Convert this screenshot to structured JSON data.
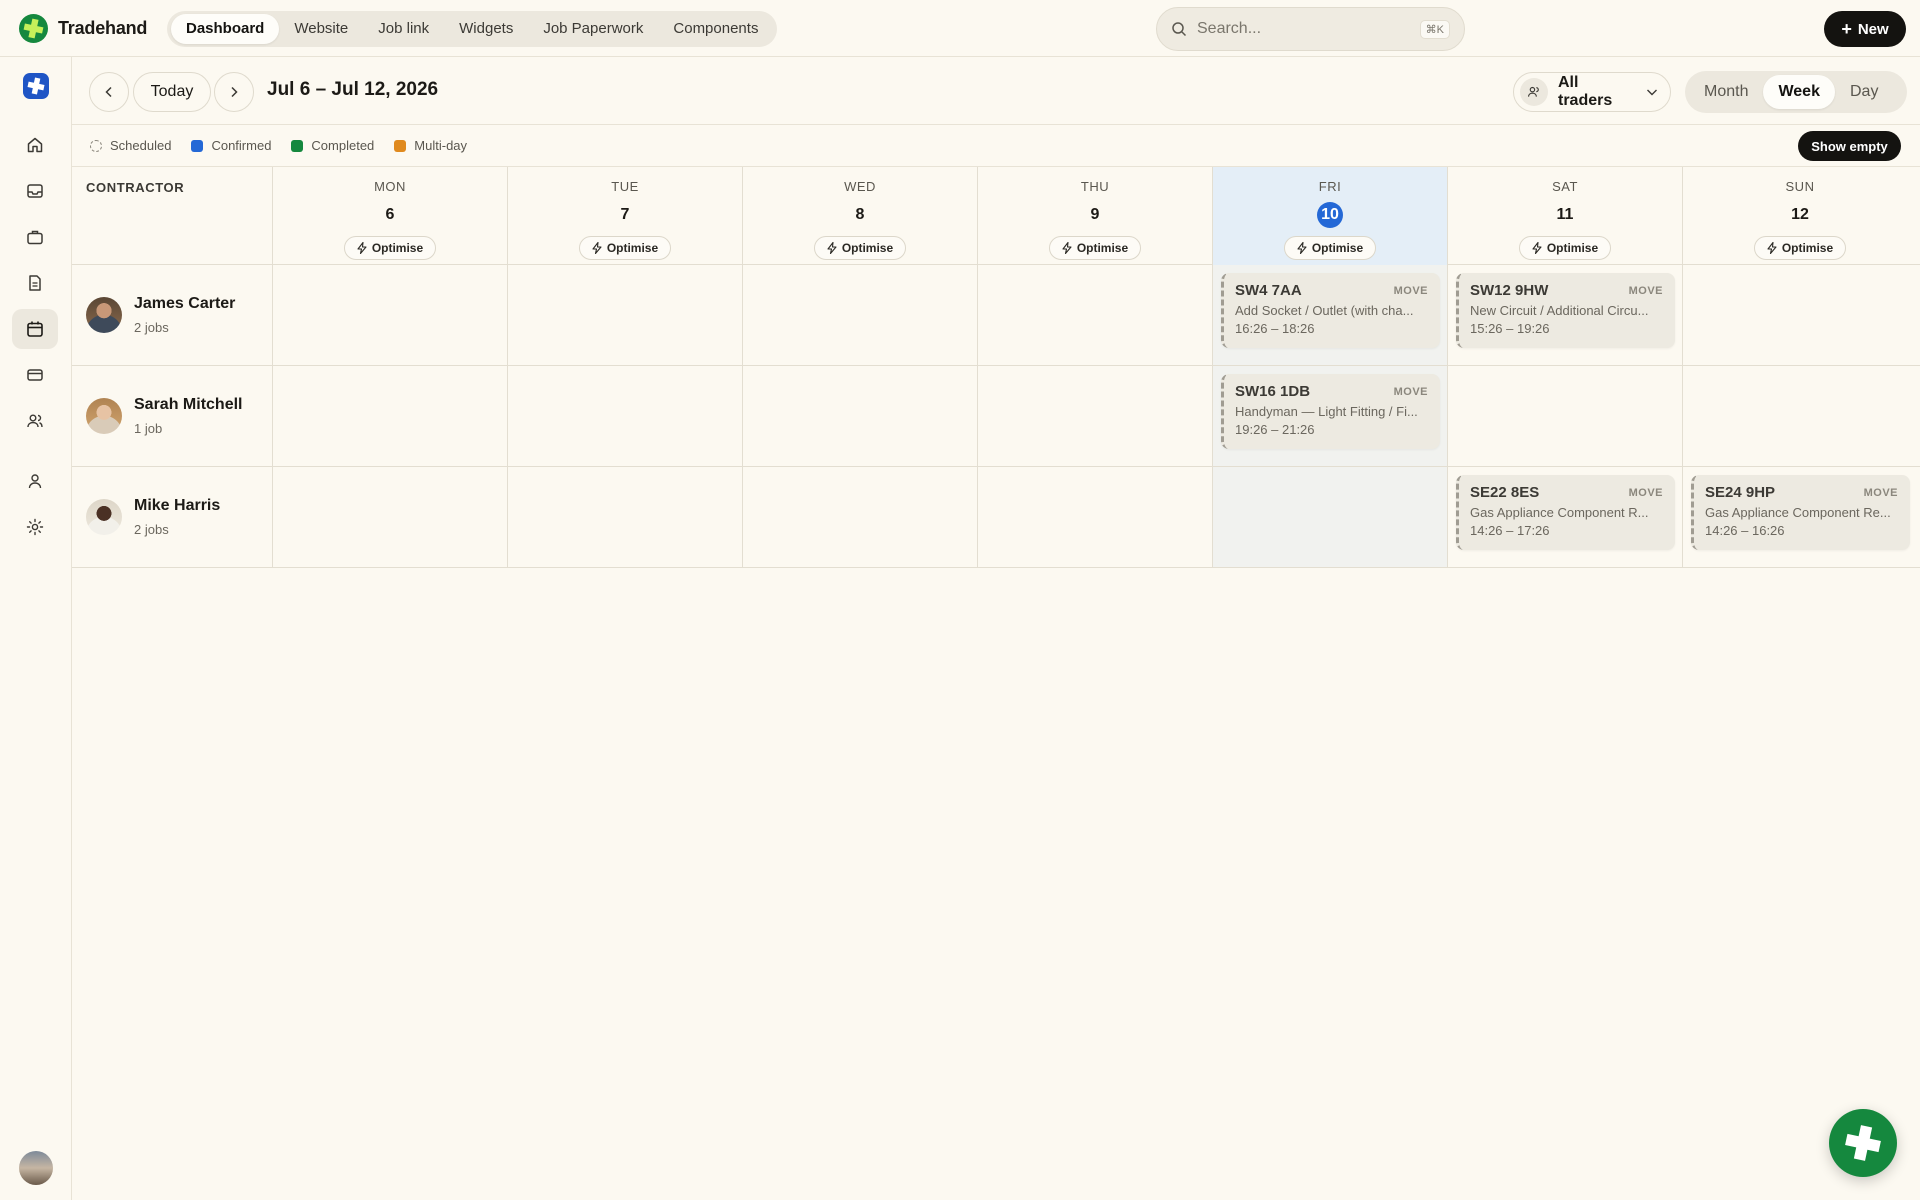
{
  "brand": {
    "name": "Tradehand"
  },
  "nav": {
    "tabs": [
      "Dashboard",
      "Website",
      "Job link",
      "Widgets",
      "Job Paperwork",
      "Components"
    ],
    "active": "Dashboard"
  },
  "search": {
    "placeholder": "Search...",
    "shortcut": "⌘K"
  },
  "new_button": {
    "label": "New"
  },
  "toolbar": {
    "today_label": "Today",
    "range": "Jul 6 – Jul 12, 2026",
    "traders_label": "All traders",
    "views": [
      "Month",
      "Week",
      "Day"
    ],
    "active_view": "Week"
  },
  "legend": {
    "items": [
      {
        "label": "Scheduled",
        "color": "dashed"
      },
      {
        "label": "Confirmed",
        "color": "#2468d6"
      },
      {
        "label": "Completed",
        "color": "#15883e"
      },
      {
        "label": "Multi-day",
        "color": "#e08a1e"
      }
    ],
    "show_empty_label": "Show empty"
  },
  "grid": {
    "contractor_header": "CONTRACTOR",
    "optimise_label": "Optimise",
    "days": [
      {
        "name": "MON",
        "num": "6"
      },
      {
        "name": "TUE",
        "num": "7"
      },
      {
        "name": "WED",
        "num": "8"
      },
      {
        "name": "THU",
        "num": "9"
      },
      {
        "name": "FRI",
        "num": "10",
        "today": true
      },
      {
        "name": "SAT",
        "num": "11"
      },
      {
        "name": "SUN",
        "num": "12"
      }
    ],
    "contractors": [
      {
        "name": "James Carter",
        "jobs": "2 jobs",
        "cells": [
          null,
          null,
          null,
          null,
          {
            "code": "SW4 7AA",
            "move": "MOVE",
            "desc": "Add Socket / Outlet (with cha...",
            "time": "16:26 – 18:26"
          },
          {
            "code": "SW12 9HW",
            "move": "MOVE",
            "desc": "New Circuit / Additional Circu...",
            "time": "15:26 – 19:26"
          },
          null
        ]
      },
      {
        "name": "Sarah Mitchell",
        "jobs": "1 job",
        "cells": [
          null,
          null,
          null,
          null,
          {
            "code": "SW16 1DB",
            "move": "MOVE",
            "desc": "Handyman — Light Fitting / Fi...",
            "time": "19:26 – 21:26"
          },
          null,
          null
        ]
      },
      {
        "name": "Mike Harris",
        "jobs": "2 jobs",
        "cells": [
          null,
          null,
          null,
          null,
          null,
          {
            "code": "SE22 8ES",
            "move": "MOVE",
            "desc": "Gas Appliance Component R...",
            "time": "14:26 – 17:26"
          },
          {
            "code": "SE24 9HP",
            "move": "MOVE",
            "desc": "Gas Appliance Component Re...",
            "time": "14:26 – 16:26"
          }
        ]
      }
    ]
  },
  "sidebar": {
    "icons": [
      "home-icon",
      "inbox-icon",
      "briefcase-icon",
      "document-icon",
      "calendar-icon",
      "card-icon",
      "users-icon",
      "person-icon",
      "settings-icon"
    ],
    "active": "calendar-icon"
  }
}
